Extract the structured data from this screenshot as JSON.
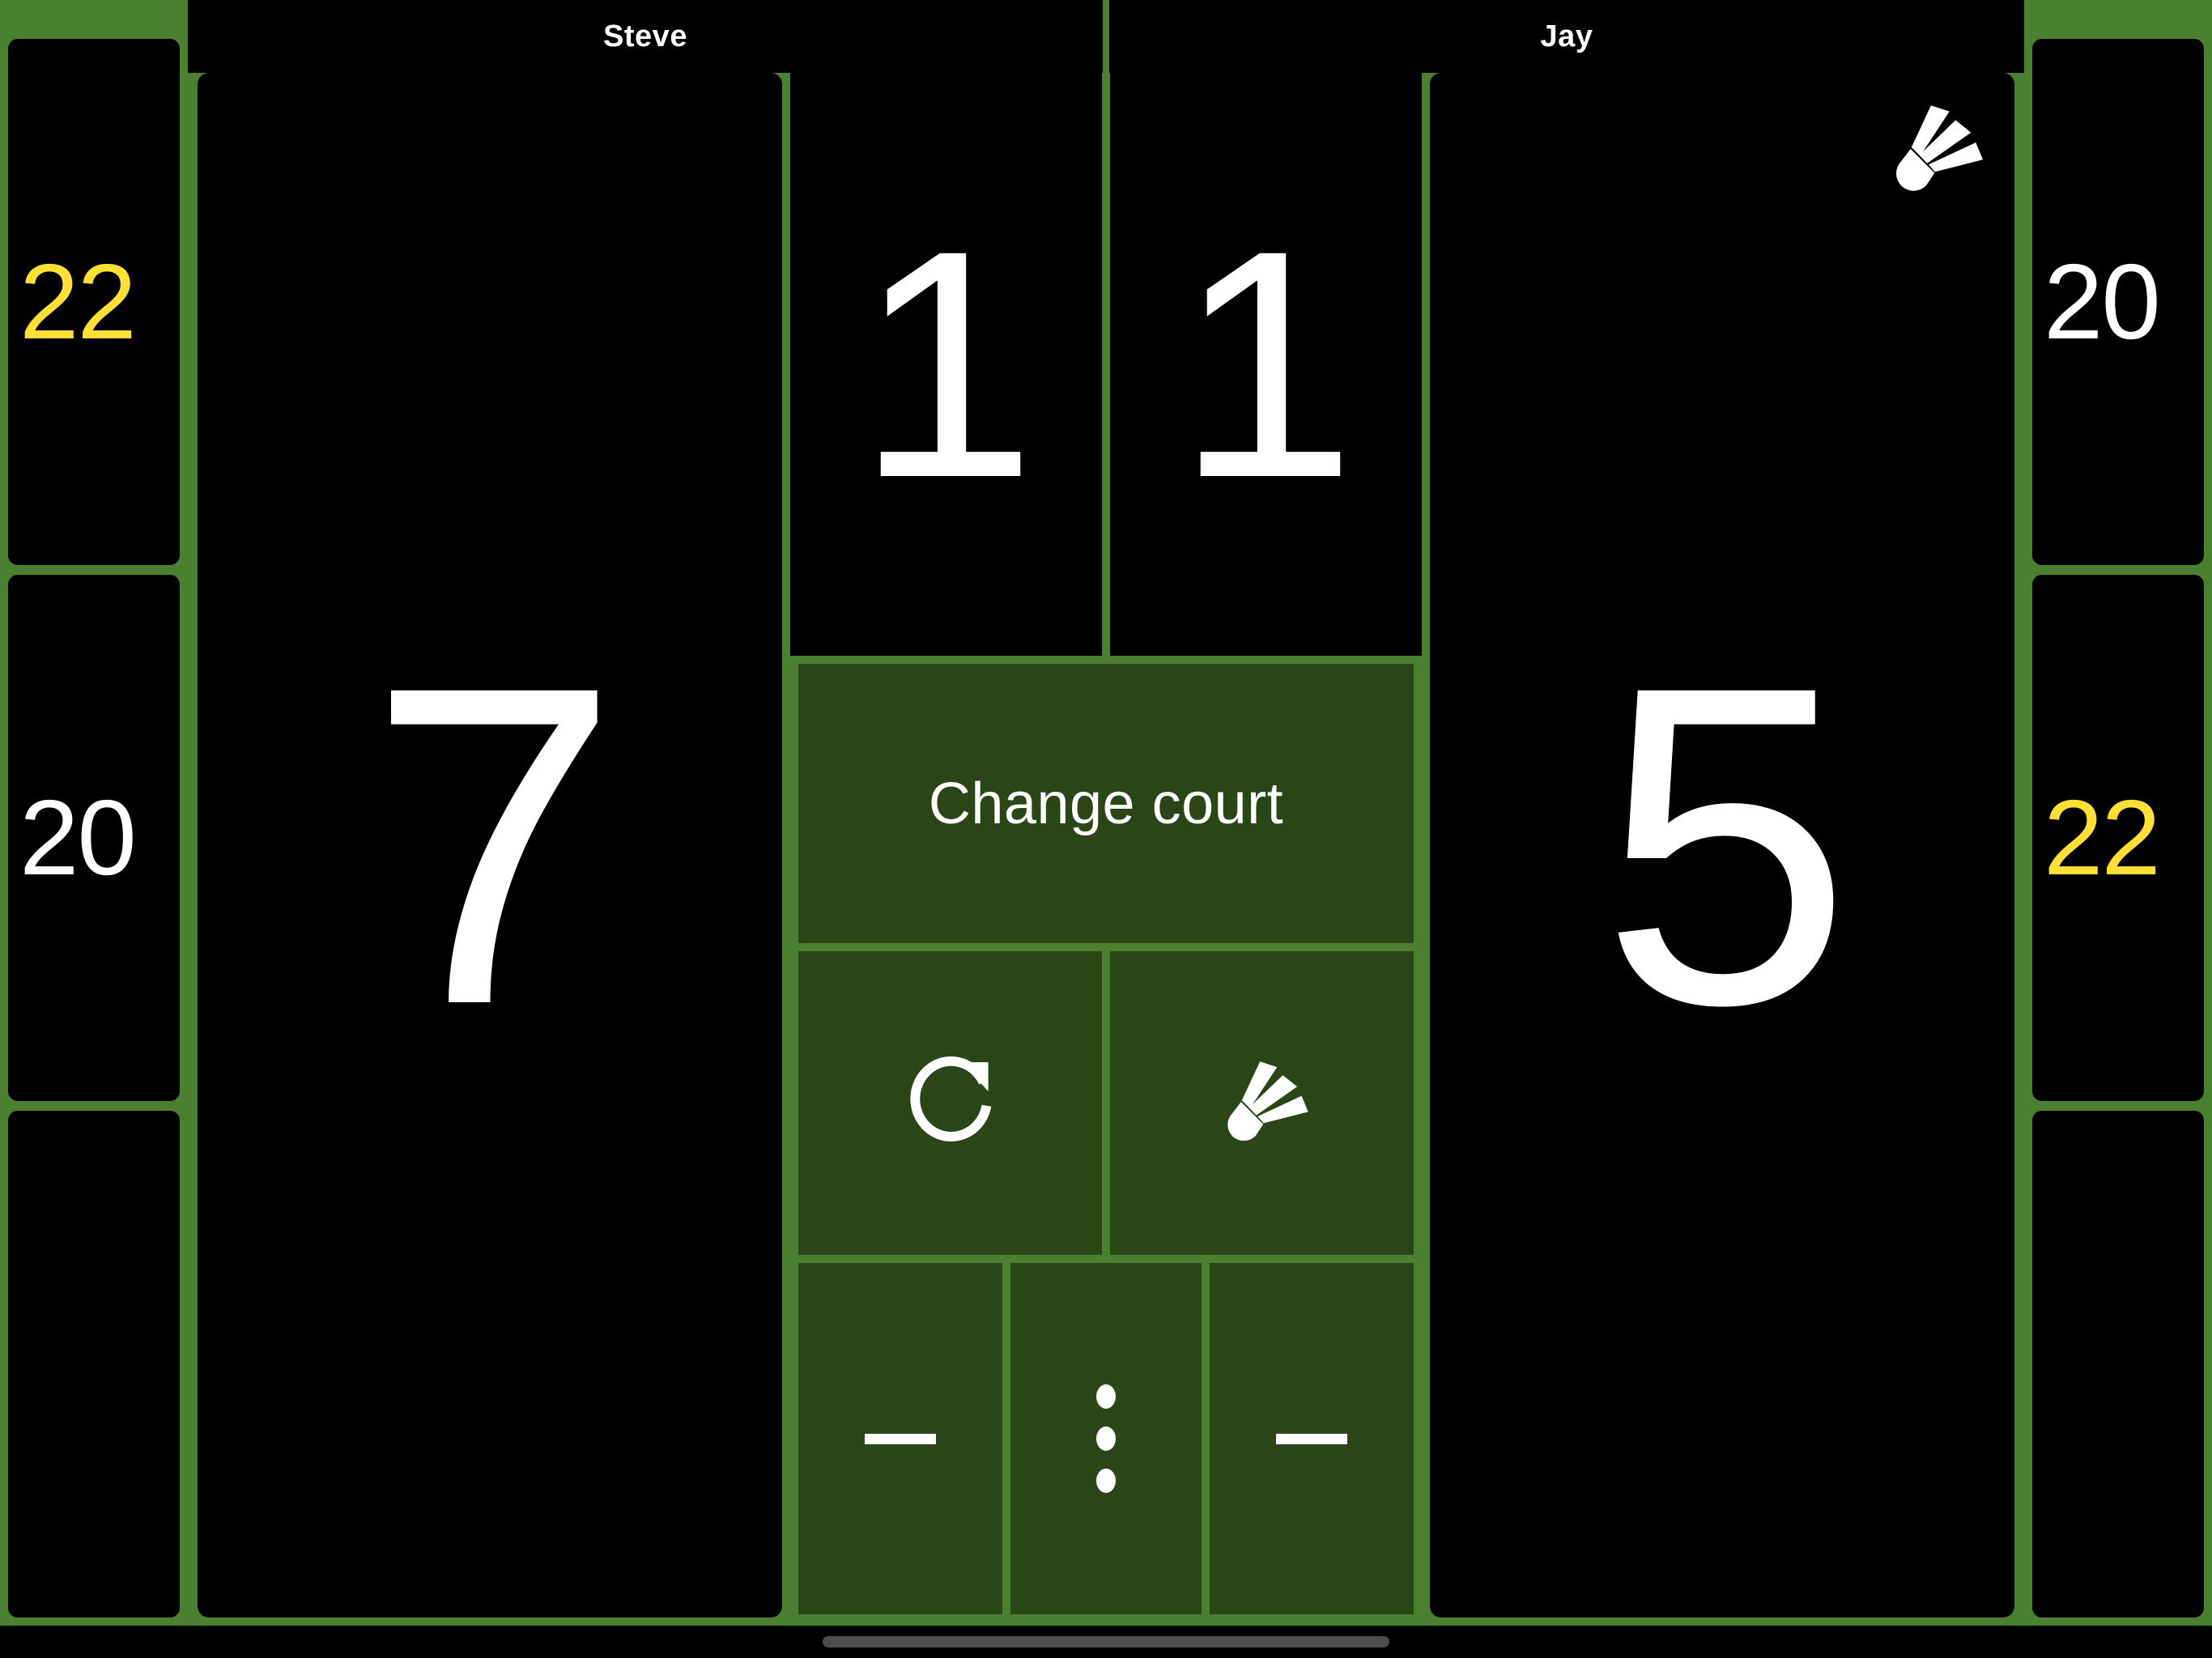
{
  "app": {
    "accent_green": "#4a8030",
    "button_green": "#2a4617",
    "panel_black": "#000000",
    "highlight_yellow": "#ffe033",
    "text_white": "#ffffff"
  },
  "players": {
    "left": {
      "name": "Steve",
      "current_score": "7",
      "sets_won": "1",
      "serving": false
    },
    "right": {
      "name": "Jay",
      "current_score": "5",
      "sets_won": "1",
      "serving": true
    }
  },
  "history": {
    "left_column": [
      {
        "value": "22",
        "result": "win"
      },
      {
        "value": "20",
        "result": "lose"
      },
      {
        "value": "",
        "result": "empty"
      }
    ],
    "right_column": [
      {
        "value": "20",
        "result": "lose"
      },
      {
        "value": "22",
        "result": "win"
      },
      {
        "value": "",
        "result": "empty"
      }
    ]
  },
  "controls": {
    "change_court_label": "Change court",
    "undo_icon": "redo-icon",
    "shuttle_icon": "shuttlecock-icon",
    "decrement_left_icon": "minus-icon",
    "overflow_menu_icon": "three-dots-vertical-icon",
    "decrement_right_icon": "minus-icon"
  },
  "system": {
    "home_indicator": "home-indicator-bar"
  }
}
